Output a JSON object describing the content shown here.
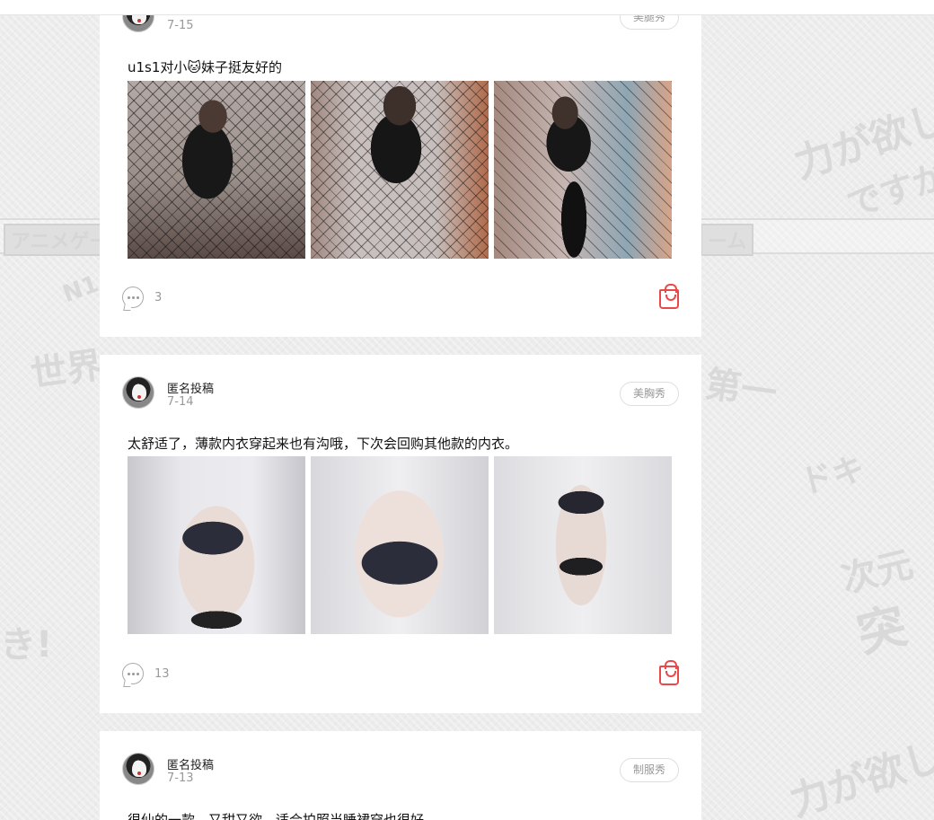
{
  "background": {
    "band_left": "アニメゲー",
    "band_right": "ーム",
    "decor_words": [
      "力が欲しい",
      "ですか",
      "世界",
      "第一",
      "ドキ",
      "次元",
      "突",
      "き!",
      "N1"
    ]
  },
  "posts": [
    {
      "author": "",
      "date": "7-15",
      "tag": "美腿秀",
      "text": "u1s1对小🐱妹子挺友好的",
      "comment_count": "3",
      "photos": [
        "ph-dark",
        "ph-dark2",
        "ph-dark3"
      ]
    },
    {
      "author": "匿名投稿",
      "date": "7-14",
      "tag": "美胸秀",
      "text": "太舒适了，薄款内衣穿起来也有沟哦，下次会回购其他款的内衣。",
      "comment_count": "13",
      "photos": [
        "ph-light",
        "ph-light2",
        "ph-light3"
      ]
    },
    {
      "author": "匿名投稿",
      "date": "7-13",
      "tag": "制服秀",
      "text": "很仙的一款，又甜又欲，适合拍照当睡裙穿也很好"
    }
  ],
  "colors": {
    "accent_red": "#e84a4a",
    "page_bg": "#ececec"
  },
  "icons": {
    "comment": "comment-icon",
    "cart": "shopping-bag-icon"
  }
}
